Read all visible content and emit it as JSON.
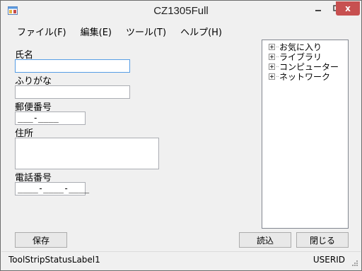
{
  "window": {
    "title": "CZ1305Full",
    "icon": "app-window-icon",
    "controls": {
      "minimize": "minimize-icon",
      "maximize": "maximize-icon",
      "close": "close-icon",
      "close_glyph": "x"
    }
  },
  "menu": [
    {
      "label": "ファイル(F)"
    },
    {
      "label": "編集(E)"
    },
    {
      "label": "ツール(T)"
    },
    {
      "label": "ヘルプ(H)"
    }
  ],
  "form": {
    "name_label": "氏名",
    "name_value": "",
    "kana_label": "ふりがな",
    "kana_value": "",
    "postal_label": "郵便番号",
    "postal_mask": "___-____",
    "address_label": "住所",
    "phone_label": "電話番号",
    "phone_mask": "____-____-____"
  },
  "tree": [
    {
      "label": "お気に入り"
    },
    {
      "label": "ライブラリ"
    },
    {
      "label": "コンピューター"
    },
    {
      "label": "ネットワーク"
    }
  ],
  "buttons": {
    "save": "保存",
    "load": "読込",
    "close": "閉じる"
  },
  "status": {
    "left": "ToolStripStatusLabel1",
    "right": "USERID"
  }
}
